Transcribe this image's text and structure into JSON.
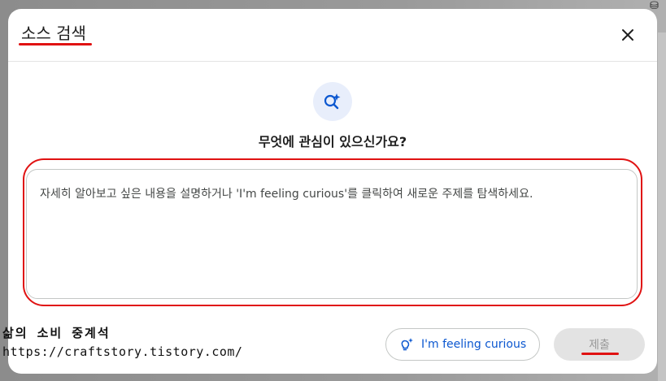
{
  "dialog": {
    "title": "소스 검색",
    "close_icon": "close-icon",
    "hero_icon": "search-sparkle-icon",
    "heading": "무엇에 관심이 있으신가요?",
    "query_placeholder": "자세히 알아보고 싶은 내용을 설명하거나 'I'm feeling curious'를 클릭하여 새로운 주제를 탐색하세요.",
    "curious_button": {
      "label": "I'm feeling curious",
      "icon": "lightbulb-sparkle-icon"
    },
    "submit_button": {
      "label": "제출",
      "enabled": false
    }
  },
  "watermark": {
    "line1": "삶의 소비 중계석",
    "line2": "https://craftstory.tistory.com/"
  },
  "colors": {
    "accent_blue": "#0b57d0",
    "annotation_red": "#e01212",
    "disabled_bg": "#e3e3e3"
  }
}
